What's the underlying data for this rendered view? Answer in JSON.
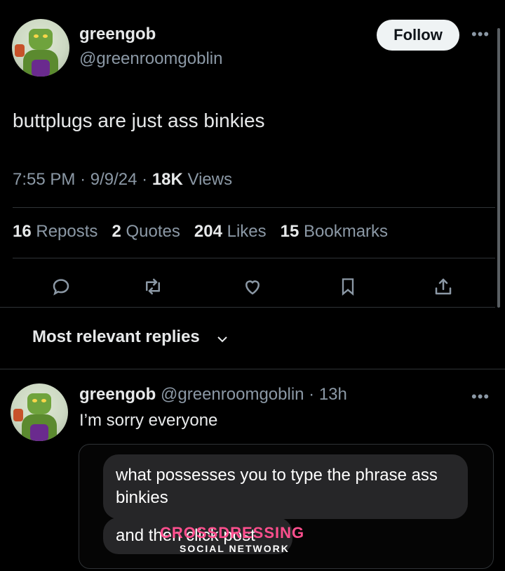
{
  "tweet": {
    "author_name": "greengob",
    "author_handle": "@greenroomgoblin",
    "follow_label": "Follow",
    "more_icon": "more-icon",
    "text": "buttplugs are just ass binkies",
    "time": "7:55 PM",
    "date": "9/9/24",
    "views_count": "18K",
    "views_label": "Views",
    "stats": {
      "reposts_count": "16",
      "reposts_label": "Reposts",
      "quotes_count": "2",
      "quotes_label": "Quotes",
      "likes_count": "204",
      "likes_label": "Likes",
      "bookmarks_count": "15",
      "bookmarks_label": "Bookmarks"
    },
    "actions": [
      "reply-icon",
      "repost-icon",
      "like-icon",
      "bookmark-icon",
      "share-icon"
    ]
  },
  "replies": {
    "sort_label": "Most relevant replies"
  },
  "reply": {
    "author_name": "greengob",
    "author_handle": "@greenroomgoblin",
    "time_ago": "13h",
    "text": "I’m sorry everyone",
    "embedded_messages": [
      "what possesses you to type the phrase ass binkies",
      "and then click post"
    ]
  },
  "watermark": {
    "title": "CROSSDRESSING",
    "subtitle": "SOCIAL NETWORK"
  },
  "colors": {
    "background": "#000000",
    "text_primary": "#e7e9ea",
    "text_secondary": "#8b98a5",
    "divider": "#2f3336",
    "bubble": "#262628",
    "watermark_accent": "#ff4f8e"
  }
}
